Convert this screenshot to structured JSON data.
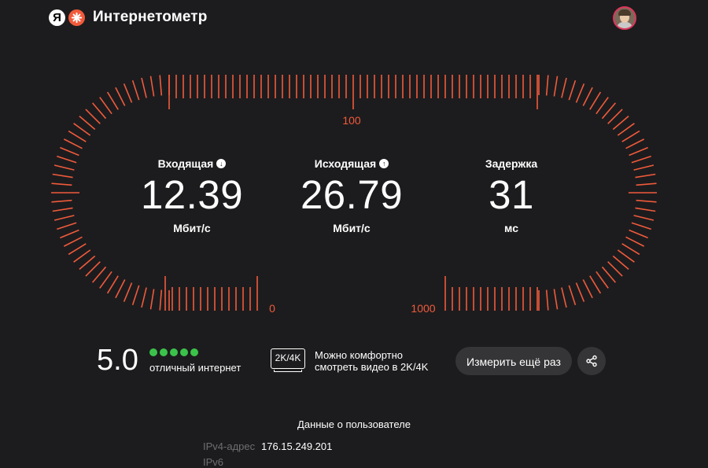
{
  "header": {
    "logo_letter": "Я",
    "title": "Интернетометр"
  },
  "gauge": {
    "scale_labels": {
      "top": "100",
      "left_bottom": "0",
      "right_bottom": "1000"
    },
    "accent_color": "#f15a3b"
  },
  "metrics": [
    {
      "label": "Входящая",
      "icon": "arrow-down-icon",
      "value": "12.39",
      "unit": "Мбит/с"
    },
    {
      "label": "Исходящая",
      "icon": "arrow-up-icon",
      "value": "26.79",
      "unit": "Мбит/с"
    },
    {
      "label": "Задержка",
      "value": "31",
      "unit": "мс"
    }
  ],
  "rating": {
    "score": "5.0",
    "stars_filled": 5,
    "stars_total": 5,
    "text": "отличный интернет",
    "dot_color": "#3bc24a"
  },
  "video": {
    "badge": "2K/4K",
    "line1": "Можно комфортно",
    "line2": "смотреть видео в 2K/4K"
  },
  "actions": {
    "measure_again": "Измерить ещё раз",
    "share_icon": "share-icon"
  },
  "user_data": {
    "title": "Данные о пользователе",
    "ipv4_label": "IPv4-адрес",
    "ipv4_value": "176.15.249.201",
    "ipv6_label": "IPv6"
  }
}
